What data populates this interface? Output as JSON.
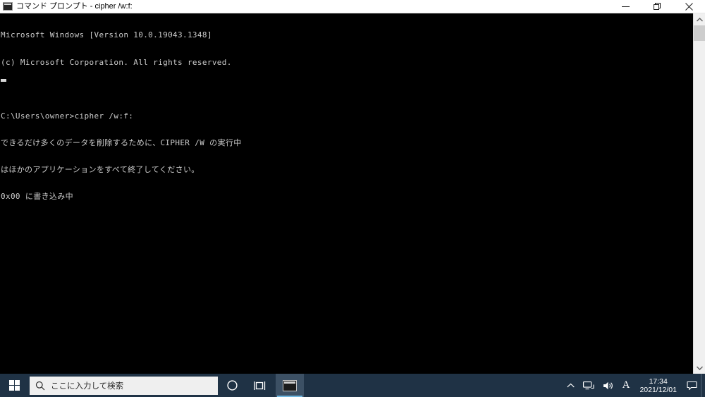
{
  "window": {
    "title": "コマンド プロンプト - cipher  /w:f:",
    "icon": "console-icon",
    "minimize_label": "最小化",
    "maximize_label": "最大化",
    "close_label": "閉じる"
  },
  "console": {
    "background_color": "#000000",
    "text_color": "#cccccc",
    "lines": [
      "Microsoft Windows [Version 10.0.19043.1348]",
      "(c) Microsoft Corporation. All rights reserved.",
      "",
      "C:\\Users\\owner>cipher /w:f:",
      "できるだけ多くのデータを削除するために、CIPHER /W の実行中",
      "はほかのアプリケーションをすべて終了してください。",
      "0x00 に書き込み中"
    ],
    "cursor": "block"
  },
  "scrollbar": {
    "up_arrow": "chevron-up-icon",
    "down_arrow": "chevron-down-icon",
    "thumb_position": "top"
  },
  "taskbar": {
    "background_color": "#1f3245",
    "start_label": "スタート",
    "search": {
      "placeholder": "ここに入力して検索",
      "icon": "search-icon"
    },
    "cortana_label": "Cortana",
    "task_view_label": "タスク ビュー",
    "apps": [
      {
        "name": "コマンド プロンプト",
        "icon": "console-icon",
        "active": true
      }
    ],
    "tray": {
      "overflow_icon": "chevron-up-icon",
      "network_icon": "network-icon",
      "volume_icon": "speaker-icon",
      "ime_label": "A",
      "clock_time": "17:34",
      "clock_date": "2021/12/01",
      "notification_icon": "notification-icon"
    }
  }
}
